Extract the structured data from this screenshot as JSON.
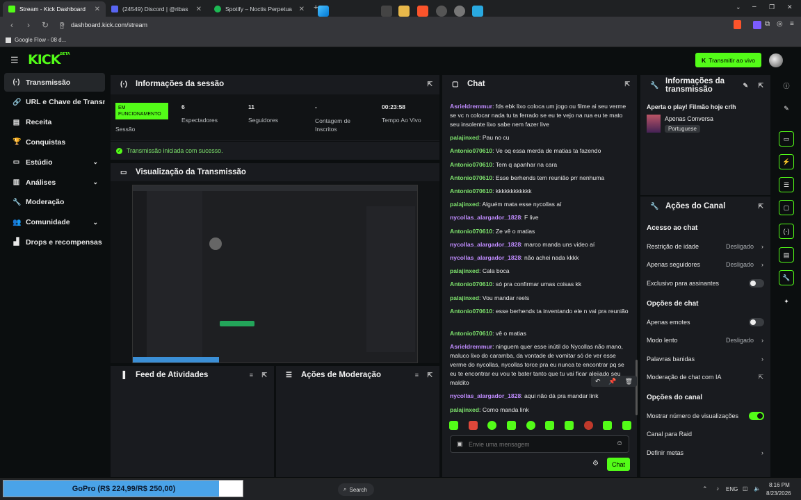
{
  "browser": {
    "tabs": [
      {
        "label": "Stream - Kick Dashboard",
        "active": true,
        "color": "#53fc18"
      },
      {
        "label": "(24549) Discord | @ribas",
        "active": false,
        "color": "#5865f2"
      },
      {
        "label": "Spotify – Noctis Perpetua",
        "active": false,
        "color": "#1db954"
      }
    ],
    "url": "dashboard.kick.com/stream",
    "bookmark": "Google Flow - 08 d..."
  },
  "header": {
    "logo": "KICK",
    "beta": "BETA",
    "go_live": "Transmitir ao vivo"
  },
  "sidebar": {
    "items": [
      {
        "label": "Transmissão",
        "icon": "broadcast-icon",
        "active": true,
        "chevron": false
      },
      {
        "label": "URL e Chave de Transmissão",
        "icon": "link-icon",
        "active": false,
        "chevron": false
      },
      {
        "label": "Receita",
        "icon": "receipt-icon",
        "active": false,
        "chevron": false
      },
      {
        "label": "Conquistas",
        "icon": "trophy-icon",
        "active": false,
        "chevron": false
      },
      {
        "label": "Estúdio",
        "icon": "studio-icon",
        "active": false,
        "chevron": true
      },
      {
        "label": "Análises",
        "icon": "analytics-icon",
        "active": false,
        "chevron": true
      },
      {
        "label": "Moderação",
        "icon": "wrench-icon",
        "active": false,
        "chevron": false
      },
      {
        "label": "Comunidade",
        "icon": "people-icon",
        "active": false,
        "chevron": true
      },
      {
        "label": "Drops e recompensas",
        "icon": "chart-icon",
        "active": false,
        "chevron": false
      }
    ]
  },
  "session": {
    "title": "Informações da sessão",
    "status_badge": "EM FUNCIONAMENTO",
    "stats": [
      {
        "value": "",
        "label": "Sessão"
      },
      {
        "value": "6",
        "label": "Espectadores"
      },
      {
        "value": "11",
        "label": "Seguidores"
      },
      {
        "value": "-",
        "label": "Contagem de Inscritos"
      },
      {
        "value": "00:23:58",
        "label": "Tempo Ao Vivo"
      }
    ],
    "success_message": "Transmissão iniciada com sucesso."
  },
  "preview": {
    "title": "Visualização da Transmissão"
  },
  "activity": {
    "title": "Feed de Atividades"
  },
  "moderation": {
    "title": "Ações de Moderação"
  },
  "chat": {
    "title": "Chat",
    "messages": [
      {
        "user": "Asrieldremmur",
        "color": "purple",
        "text": "fds ebk lixo coloca um jogo ou filme ai seu verme se vc n colocar nada tu ta ferrado se eu te vejo na rua eu te mato seu insolente lixo sabe nem fazer live"
      },
      {
        "user": "palajinxed",
        "color": "green",
        "text": "Pau no cu"
      },
      {
        "user": "Antonio070610",
        "color": "green",
        "text": "Ve oq essa merda de matias ta fazendo"
      },
      {
        "user": "Antonio070610",
        "color": "green",
        "text": "Tem q apanhar na cara"
      },
      {
        "user": "Antonio070610",
        "color": "green",
        "text": "Esse berhends tem reunião prr nenhuma"
      },
      {
        "user": "Antonio070610",
        "color": "green",
        "text": "kkkkkkkkkkkk"
      },
      {
        "user": "palajinxed",
        "color": "green",
        "text": "Alguém mata esse nycollas aí"
      },
      {
        "user": "nycollas_alargador_1828",
        "color": "purple",
        "text": "F live"
      },
      {
        "user": "Antonio070610",
        "color": "green",
        "text": "Ze vê o matias"
      },
      {
        "user": "nycollas_alargador_1828",
        "color": "purple",
        "text": "marco manda uns video aí"
      },
      {
        "user": "nycollas_alargador_1828",
        "color": "purple",
        "text": "não achei nada kkkk"
      },
      {
        "user": "palajinxed",
        "color": "green",
        "text": "Cala boca"
      },
      {
        "user": "Antonio070610",
        "color": "green",
        "text": "só pra confirmar umas coisas kk"
      },
      {
        "user": "palajinxed",
        "color": "green",
        "text": "Vou mandar reels"
      },
      {
        "user": "Antonio070610",
        "color": "green",
        "text": "esse berhends ta inventando ele n vai pra reunião"
      },
      {
        "user": "Antonio070610",
        "color": "green",
        "text": "vê o matias"
      },
      {
        "user": "Asrieldremmur",
        "color": "purple",
        "text": "ninguem quer esse inútil do Nycollas não mano, maluco lixo do caramba, da vontade de vomitar só de ver esse verme do nycollas, nycollas torce pra eu nunca te encontrar pq se eu te encontrar eu vou te bater tanto que tu vai ficar aleijado seu maldito"
      },
      {
        "user": "nycollas_alargador_1828",
        "color": "purple",
        "text": "aqui não dá pra mandar link"
      },
      {
        "user": "palajinxed",
        "color": "green",
        "text": "Como manda link"
      }
    ],
    "input_placeholder": "Envie uma mensagem",
    "send_label": "Chat"
  },
  "stream_info": {
    "title": "Informações da transmissão",
    "stream_title": "Aperta o play! Filmão hoje crlh",
    "category": "Apenas Conversa",
    "language": "Portuguese"
  },
  "channel_actions": {
    "title": "Ações do Canal",
    "sections": [
      {
        "heading": "Acesso ao chat",
        "rows": [
          {
            "label": "Restrição de idade",
            "value": "Desligado",
            "control": "chevron"
          },
          {
            "label": "Apenas seguidores",
            "value": "Desligado",
            "control": "chevron"
          },
          {
            "label": "Exclusivo para assinantes",
            "value": "",
            "control": "toggle-off"
          }
        ]
      },
      {
        "heading": "Opções de chat",
        "rows": [
          {
            "label": "Apenas emotes",
            "value": "",
            "control": "toggle-off"
          },
          {
            "label": "Modo lento",
            "value": "Desligado",
            "control": "chevron"
          },
          {
            "label": "Palavras banidas",
            "value": "",
            "control": "chevron"
          },
          {
            "label": "Moderação de chat com IA",
            "value": "",
            "control": "external"
          }
        ]
      },
      {
        "heading": "Opções do canal",
        "rows": [
          {
            "label": "Mostrar número de visualizações",
            "value": "",
            "control": "toggle-on"
          },
          {
            "label": "Canal para Raid",
            "value": "",
            "control": "none"
          },
          {
            "label": "Definir metas",
            "value": "",
            "control": "chevron"
          }
        ]
      }
    ]
  },
  "taskbar": {
    "popup": "GoPro (R$ 224,99/R$ 250,00)",
    "popup_progress": 0.9,
    "search": "Search",
    "lang": "ENG",
    "time": "8:16 PM",
    "date": "8/23/2026"
  },
  "colors": {
    "accent": "#53fc18",
    "panel": "#191b1f",
    "bg": "#0b0e0f",
    "user_purple": "#c08cff",
    "user_green": "#7ee36d"
  }
}
